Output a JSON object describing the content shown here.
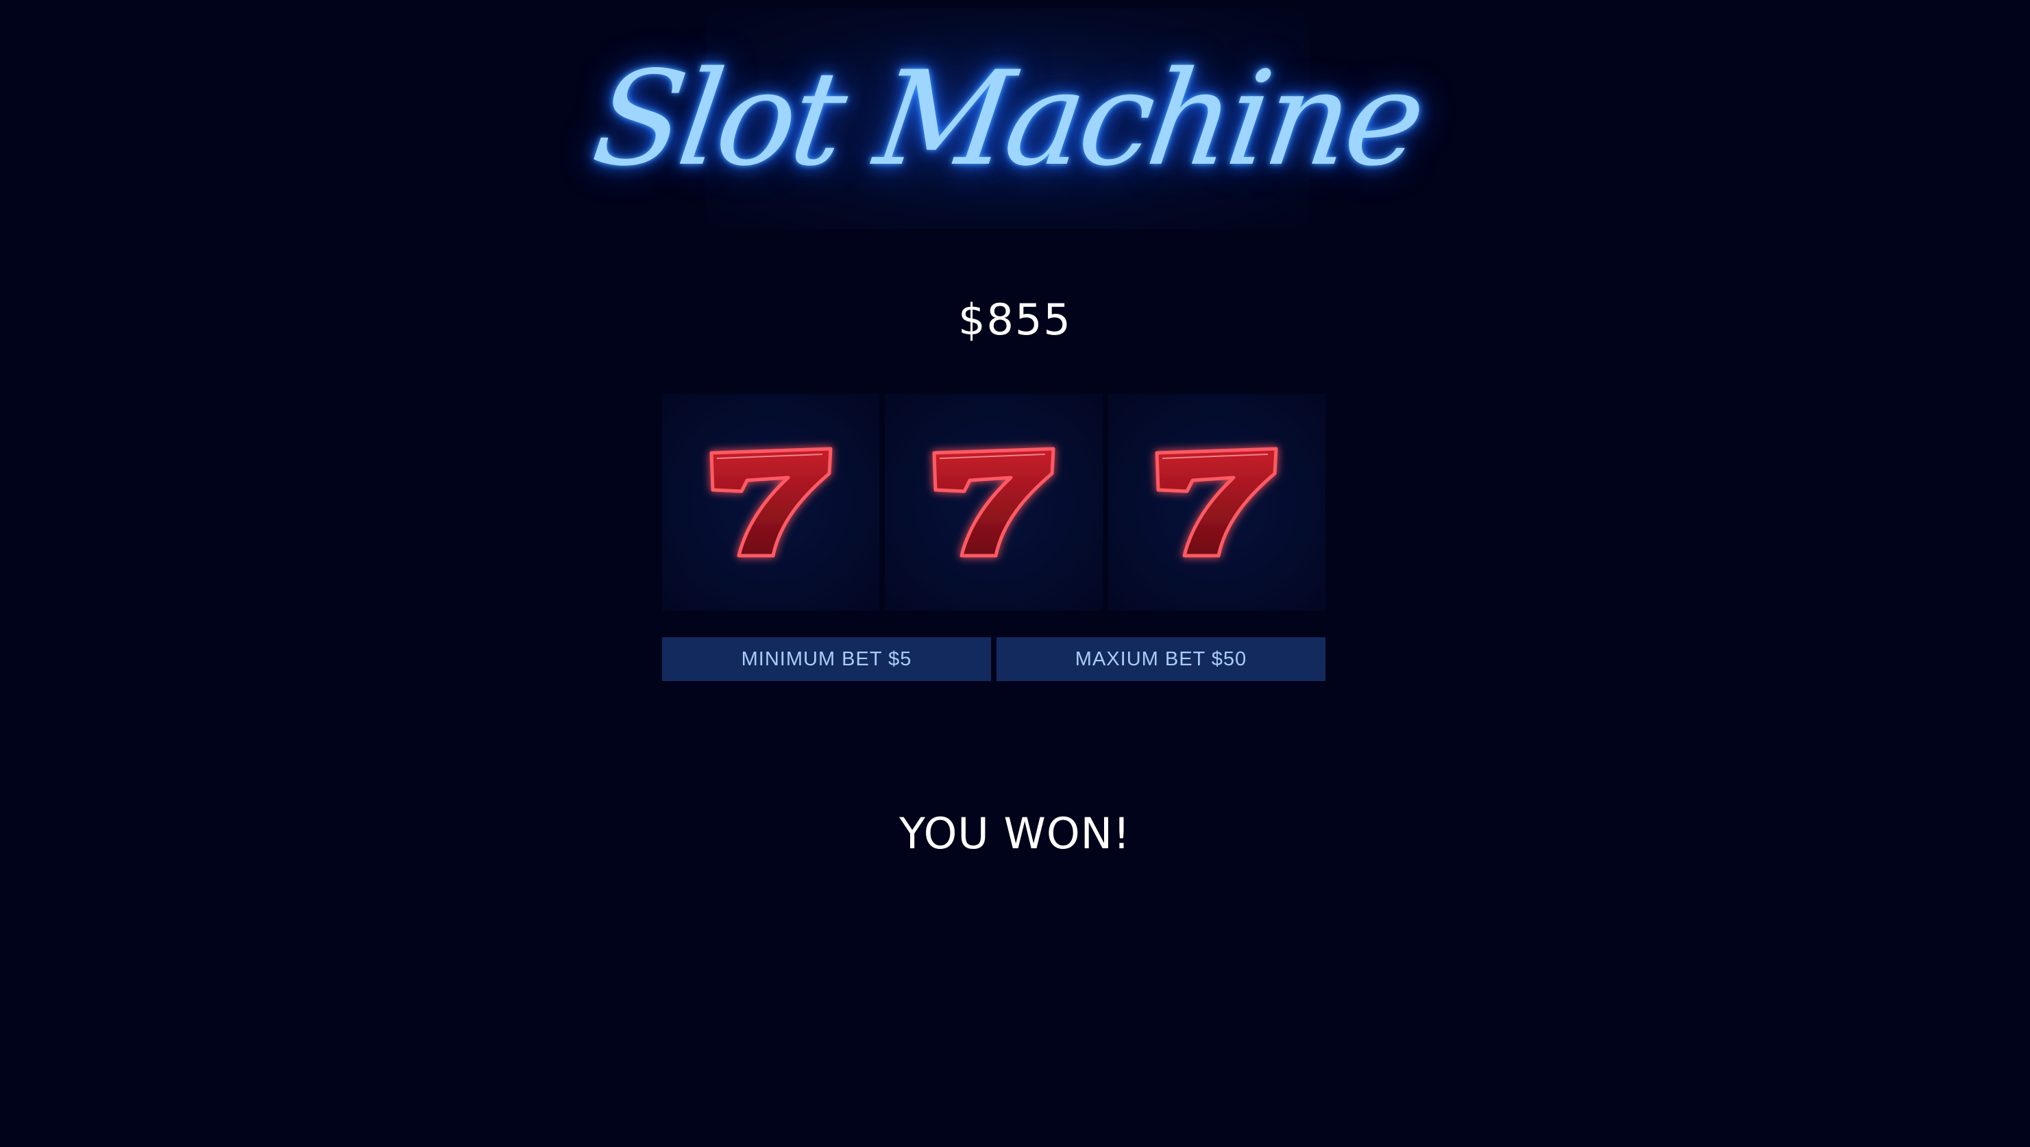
{
  "logo": {
    "title": "Slot Machine"
  },
  "balance": {
    "amount": "$855"
  },
  "reels": [
    {
      "symbol": "7",
      "icon": "seven-icon"
    },
    {
      "symbol": "7",
      "icon": "seven-icon"
    },
    {
      "symbol": "7",
      "icon": "seven-icon"
    }
  ],
  "bets": {
    "minimum_label": "MINIMUM BET $5",
    "maximum_label": "MAXIUM BET $50"
  },
  "result": {
    "message": "YOU WON!"
  },
  "colors": {
    "background": "#01031a",
    "neon_blue": "#9fd6ff",
    "button_bg": "#132a5e",
    "button_text": "#a9cdf7",
    "seven_red": "#d8202a"
  }
}
